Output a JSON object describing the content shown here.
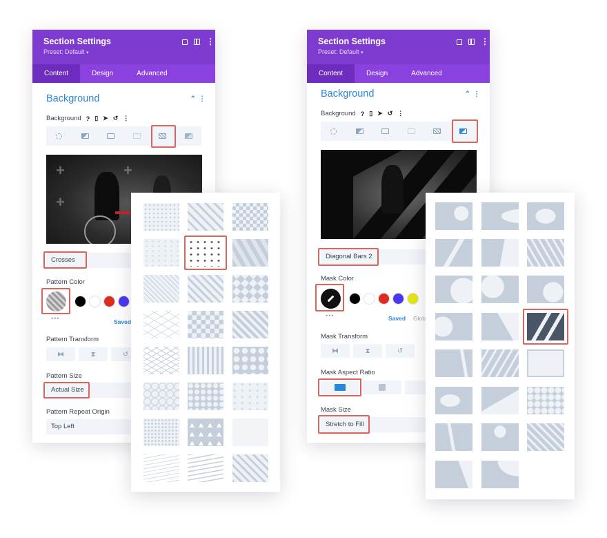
{
  "colors": {
    "purple_header": "#7e3bd0",
    "tab_bar": "#8a41e0",
    "accent_blue": "#2b87da",
    "highlight_red": "#e0625a"
  },
  "left_panel": {
    "title": "Section Settings",
    "preset": "Preset: Default",
    "tabs": [
      "Content",
      "Design",
      "Advanced"
    ],
    "section": "Background",
    "bg_label": "Background",
    "bg_label_icons": [
      "?",
      "mobile-icon",
      "cursor-icon",
      "undo-icon",
      "more-icon"
    ],
    "pattern_name": "Crosses",
    "pattern_color_label": "Pattern Color",
    "swatch_colors": [
      "#000000",
      "#ffffff",
      "#e02b20",
      "#4b37f0"
    ],
    "saved": "Saved",
    "transform_label": "Pattern Transform",
    "size_label": "Pattern Size",
    "size_value": "Actual Size",
    "repeat_label": "Pattern Repeat Origin",
    "repeat_value": "Top Left"
  },
  "right_panel": {
    "title": "Section Settings",
    "preset": "Preset: Default",
    "tabs": [
      "Content",
      "Design",
      "Advanced"
    ],
    "section": "Background",
    "bg_label": "Background",
    "mask_name": "Diagonal Bars 2",
    "mask_color_label": "Mask Color",
    "swatch_colors": [
      "#000000",
      "#ffffff",
      "#e02b20",
      "#4b37f0",
      "#e5e514"
    ],
    "saved": "Saved",
    "global": "Glob",
    "transform_label": "Mask Transform",
    "aspect_label": "Mask Aspect Ratio",
    "size_label": "Mask Size",
    "size_value": "Stretch to Fill"
  }
}
